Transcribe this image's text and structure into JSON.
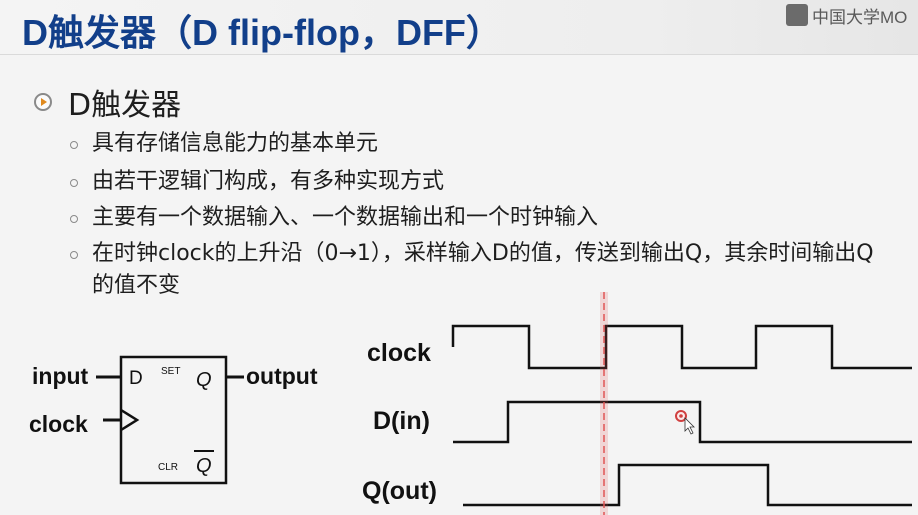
{
  "slide": {
    "title": "D触发器（D flip-flop，DFF）",
    "watermark": "中国大学MO"
  },
  "content": {
    "heading": "D触发器",
    "points": [
      "具有存储信息能力的基本单元",
      "由若干逻辑门构成，有多种实现方式",
      "主要有一个数据输入、一个数据输出和一个时钟输入",
      "在时钟clock的上升沿（0→1），采样输入D的值，传送到输出Q，其余时间输出Q的值不变"
    ]
  },
  "flipflop": {
    "input_label": "input",
    "clock_label": "clock",
    "output_label": "output",
    "pin_d": "D",
    "pin_set": "SET",
    "pin_q": "Q",
    "pin_clr": "CLR",
    "pin_qbar": "Q"
  },
  "waveform": {
    "signals": [
      {
        "label": "clock"
      },
      {
        "label": "D(in)"
      },
      {
        "label": "Q(out)"
      }
    ]
  },
  "colors": {
    "title": "#123f8a",
    "marker_line": "#e05555",
    "accent_orange": "#e08a1e"
  }
}
